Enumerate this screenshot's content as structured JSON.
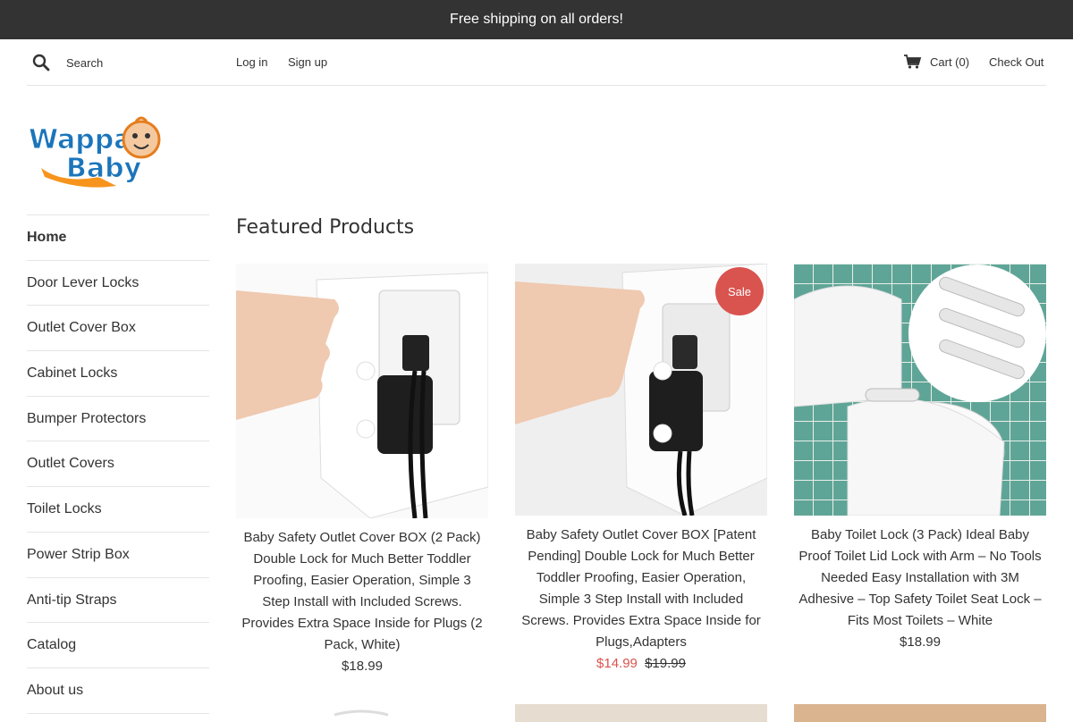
{
  "announcement": "Free shipping on all orders!",
  "header": {
    "search_placeholder": "Search",
    "login": "Log in",
    "signup": "Sign up",
    "cart": "Cart (0)",
    "checkout": "Check Out"
  },
  "logo": {
    "line1": "Wappa",
    "line2": "Baby"
  },
  "sidebar": {
    "items": [
      {
        "label": "Home"
      },
      {
        "label": "Door Lever Locks"
      },
      {
        "label": "Outlet Cover Box"
      },
      {
        "label": "Cabinet Locks"
      },
      {
        "label": "Bumper Protectors"
      },
      {
        "label": "Outlet Covers"
      },
      {
        "label": "Toilet Locks"
      },
      {
        "label": "Power Strip Box"
      },
      {
        "label": "Anti-tip Straps"
      },
      {
        "label": "Catalog"
      },
      {
        "label": "About us"
      }
    ]
  },
  "main": {
    "title": "Featured Products",
    "products": [
      {
        "title": "Baby Safety Outlet Cover BOX (2 Pack) Double Lock for Much Better Toddler Proofing, Easier Operation, Simple 3 Step Install with Included Screws. Provides Extra Space Inside for Plugs (2 Pack, White)",
        "price": "$18.99"
      },
      {
        "title": "Baby Safety Outlet Cover BOX [Patent Pending] Double Lock for Much Better Toddler Proofing, Easier Operation, Simple 3 Step Install with Included Screws. Provides Extra Space Inside for Plugs,Adapters",
        "sale_price": "$14.99",
        "compare_price": "$19.99",
        "badge": "Sale"
      },
      {
        "title": "Baby Toilet Lock (3 Pack) Ideal Baby Proof Toilet Lid Lock with Arm – No Tools Needed Easy Installation with 3M Adhesive – Top Safety Toilet Seat Lock – Fits Most Toilets – White",
        "price": "$18.99"
      }
    ]
  },
  "colors": {
    "announcement_bg": "#333333",
    "sale": "#d9534f",
    "text": "#333333"
  },
  "icons": [
    "search-icon",
    "cart-icon"
  ]
}
